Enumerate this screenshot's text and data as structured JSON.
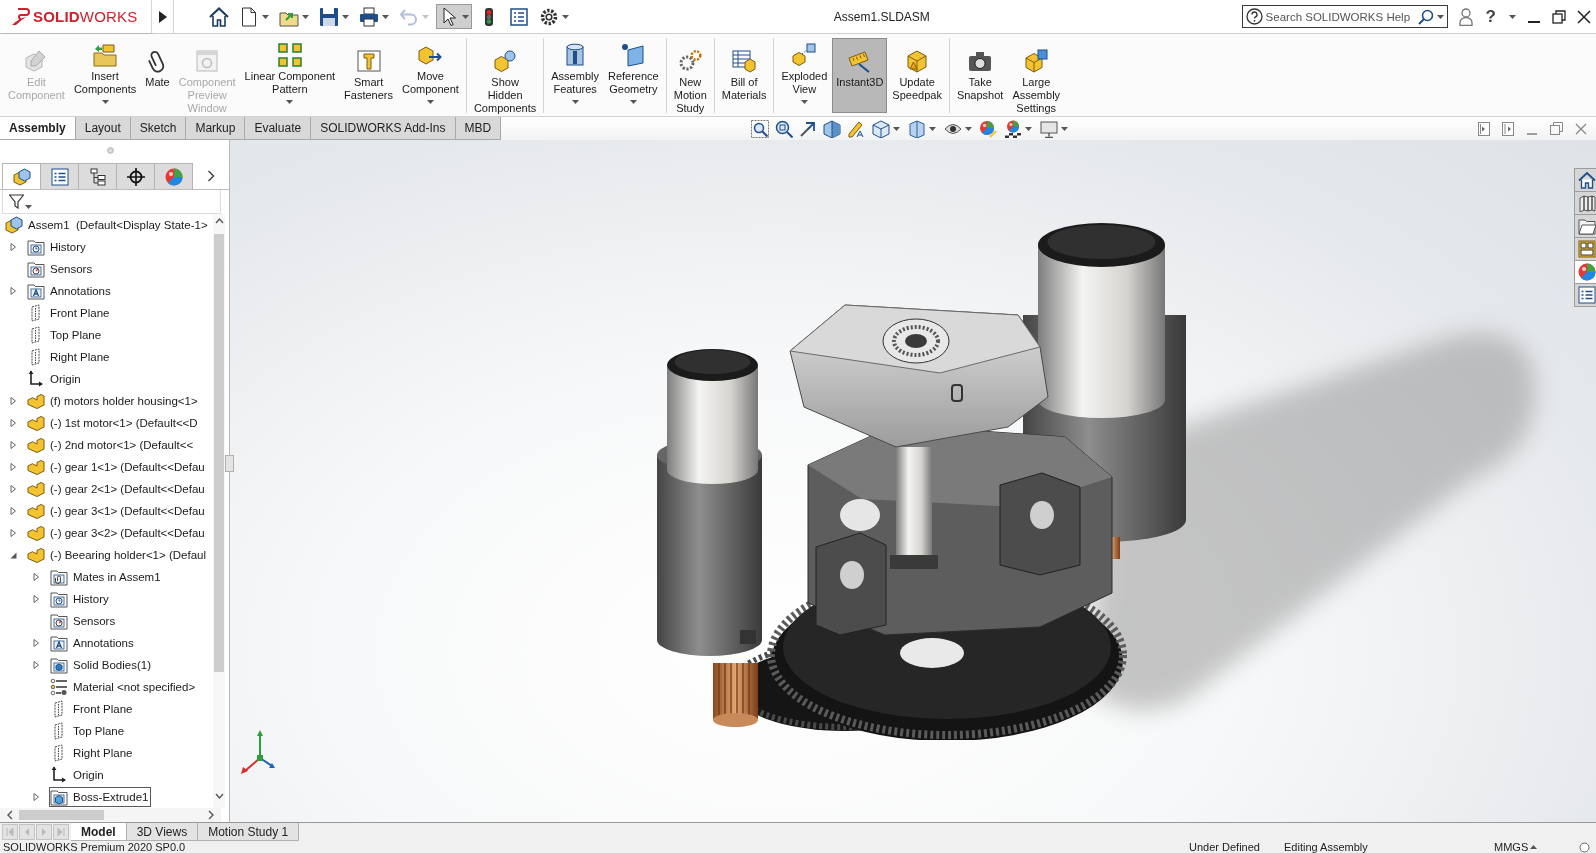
{
  "title_bar": {
    "logo": "**SOLID**WORKS",
    "quick_access": [
      {
        "dropdown": false,
        "disabled": false,
        "on": false
      },
      {
        "dropdown": true,
        "disabled": false,
        "on": false
      },
      {
        "dropdown": true,
        "disabled": false,
        "on": false
      },
      {
        "dropdown": true,
        "disabled": false,
        "on": false
      },
      {
        "dropdown": true,
        "disabled": false,
        "on": false
      },
      {
        "dropdown": true,
        "disabled": true,
        "on": false
      },
      {
        "dropdown": true,
        "disabled": false,
        "on": true
      },
      {
        "dropdown": false,
        "disabled": false,
        "on": false
      },
      {
        "dropdown": false,
        "disabled": false,
        "on": false
      },
      {
        "dropdown": true,
        "disabled": false,
        "on": false
      }
    ],
    "title": "Assem1.SLDASM",
    "search": {
      "placeholder": "Search SOLIDWORKS Help"
    },
    "help": "?"
  },
  "ribbon": {
    "groups": [
      {
        "items": [
          {
            "label": "Edit\nComponent",
            "disabled": true,
            "dropdown": false,
            "on": false
          },
          {
            "label": "Insert\nComponents",
            "disabled": false,
            "dropdown": true,
            "on": false
          },
          {
            "label": "Mate",
            "disabled": false,
            "dropdown": false,
            "on": false
          },
          {
            "label": "Component\nPreview\nWindow",
            "disabled": true,
            "dropdown": false,
            "on": false
          },
          {
            "label": "Linear Component\nPattern",
            "disabled": false,
            "dropdown": true,
            "on": false
          },
          {
            "label": "Smart\nFasteners",
            "disabled": false,
            "dropdown": false,
            "on": false
          },
          {
            "label": "Move\nComponent",
            "disabled": false,
            "dropdown": true,
            "on": false
          }
        ]
      },
      {
        "items": [
          {
            "label": "Show\nHidden\nComponents",
            "disabled": false,
            "dropdown": false,
            "on": false
          }
        ]
      },
      {
        "items": [
          {
            "label": "Assembly\nFeatures",
            "disabled": false,
            "dropdown": true,
            "on": false
          },
          {
            "label": "Reference\nGeometry",
            "disabled": false,
            "dropdown": true,
            "on": false
          }
        ]
      },
      {
        "items": [
          {
            "label": "New\nMotion\nStudy",
            "disabled": false,
            "dropdown": false,
            "on": false
          }
        ]
      },
      {
        "items": [
          {
            "label": "Bill of\nMaterials",
            "disabled": false,
            "dropdown": false,
            "on": false
          }
        ]
      },
      {
        "items": [
          {
            "label": "Exploded\nView",
            "disabled": false,
            "dropdown": true,
            "on": false
          },
          {
            "label": "Instant3D",
            "disabled": false,
            "dropdown": false,
            "on": true
          },
          {
            "label": "Update\nSpeedpak",
            "disabled": false,
            "dropdown": false,
            "on": false
          }
        ]
      },
      {
        "items": [
          {
            "label": "Take\nSnapshot",
            "disabled": false,
            "dropdown": false,
            "on": false
          },
          {
            "label": "Large\nAssembly\nSettings",
            "disabled": false,
            "dropdown": false,
            "on": false
          }
        ]
      }
    ]
  },
  "tabs": [
    {
      "label": "Assembly",
      "selected": true
    },
    {
      "label": "Layout",
      "selected": false
    },
    {
      "label": "Sketch",
      "selected": false
    },
    {
      "label": "Markup",
      "selected": false
    },
    {
      "label": "Evaluate",
      "selected": false
    },
    {
      "label": "SOLIDWORKS Add-Ins",
      "selected": false
    },
    {
      "label": "MBD",
      "selected": false
    }
  ],
  "view_toolbar": [
    {
      "dropdown": false
    },
    {
      "dropdown": false
    },
    {
      "dropdown": false
    },
    {
      "dropdown": false
    },
    {
      "dropdown": false
    },
    {
      "dropdown": true
    },
    {
      "dropdown": true
    },
    {
      "dropdown": true
    },
    {
      "dropdown": false
    },
    {
      "dropdown": true
    },
    {
      "dropdown": true
    }
  ],
  "feature_tree": {
    "panel_tabs": [
      {
        "selected": true
      },
      {
        "selected": false
      },
      {
        "selected": false
      },
      {
        "selected": false
      },
      {
        "selected": false
      }
    ],
    "tree": [
      {
        "label": "Assem1  (Default<Display State-1>",
        "kind": "assembly",
        "selected": false,
        "children": [
          {
            "label": "History",
            "kind": "history",
            "expanded": false,
            "selected": false
          },
          {
            "label": "Sensors",
            "kind": "sensors",
            "selected": false
          },
          {
            "label": "Annotations",
            "kind": "annotations",
            "expanded": false,
            "selected": false
          },
          {
            "label": "Front Plane",
            "kind": "plane",
            "selected": false
          },
          {
            "label": "Top Plane",
            "kind": "plane",
            "selected": false
          },
          {
            "label": "Right Plane",
            "kind": "plane",
            "selected": false
          },
          {
            "label": "Origin",
            "kind": "origin",
            "selected": false
          },
          {
            "label": "(f) motors holder housing<1>",
            "kind": "part",
            "expanded": false,
            "selected": false
          },
          {
            "label": "(-) 1st motor<1> (Default<<D",
            "kind": "part",
            "expanded": false,
            "selected": false
          },
          {
            "label": "(-) 2nd motor<1> (Default<<",
            "kind": "part",
            "expanded": false,
            "selected": false
          },
          {
            "label": "(-) gear 1<1> (Default<<Defau",
            "kind": "part",
            "expanded": false,
            "selected": false
          },
          {
            "label": "(-) gear 2<1> (Default<<Defau",
            "kind": "part",
            "expanded": false,
            "selected": false
          },
          {
            "label": "(-) gear 3<1> (Default<<Defau",
            "kind": "part",
            "expanded": false,
            "selected": false
          },
          {
            "label": "(-) gear 3<2> (Default<<Defau",
            "kind": "part",
            "expanded": false,
            "selected": false
          },
          {
            "label": "(-) Beearing holder<1> (Defaul",
            "kind": "part",
            "expanded": true,
            "selected": false,
            "children": [
              {
                "label": "Mates in Assem1",
                "kind": "mates",
                "expanded": false,
                "selected": false
              },
              {
                "label": "History",
                "kind": "history",
                "expanded": false,
                "selected": false
              },
              {
                "label": "Sensors",
                "kind": "sensors",
                "selected": false
              },
              {
                "label": "Annotations",
                "kind": "annotations",
                "expanded": false,
                "selected": false
              },
              {
                "label": "Solid Bodies(1)",
                "kind": "solid_bodies",
                "expanded": false,
                "selected": false
              },
              {
                "label": "Material <not specified>",
                "kind": "material",
                "selected": false
              },
              {
                "label": "Front Plane",
                "kind": "plane",
                "selected": false
              },
              {
                "label": "Top Plane",
                "kind": "plane",
                "selected": false
              },
              {
                "label": "Right Plane",
                "kind": "plane",
                "selected": false
              },
              {
                "label": "Origin",
                "kind": "origin",
                "selected": false
              },
              {
                "label": "Boss-Extrude1",
                "kind": "feature",
                "expanded": false,
                "selected": true
              }
            ]
          }
        ]
      }
    ]
  },
  "task_pane": [
    {
      "selected": false
    },
    {
      "selected": false
    },
    {
      "selected": false
    },
    {
      "selected": false
    },
    {
      "selected": true
    },
    {
      "selected": false
    }
  ],
  "bottom_tabs": [
    {
      "label": "Model",
      "selected": true
    },
    {
      "label": "3D Views",
      "selected": false
    },
    {
      "label": "Motion Study 1",
      "selected": false
    }
  ],
  "status_bar": {
    "product": "SOLIDWORKS Premium 2020 SP0.0",
    "state": "Under Defined",
    "mode": "Editing Assembly",
    "units": "MMGS"
  }
}
